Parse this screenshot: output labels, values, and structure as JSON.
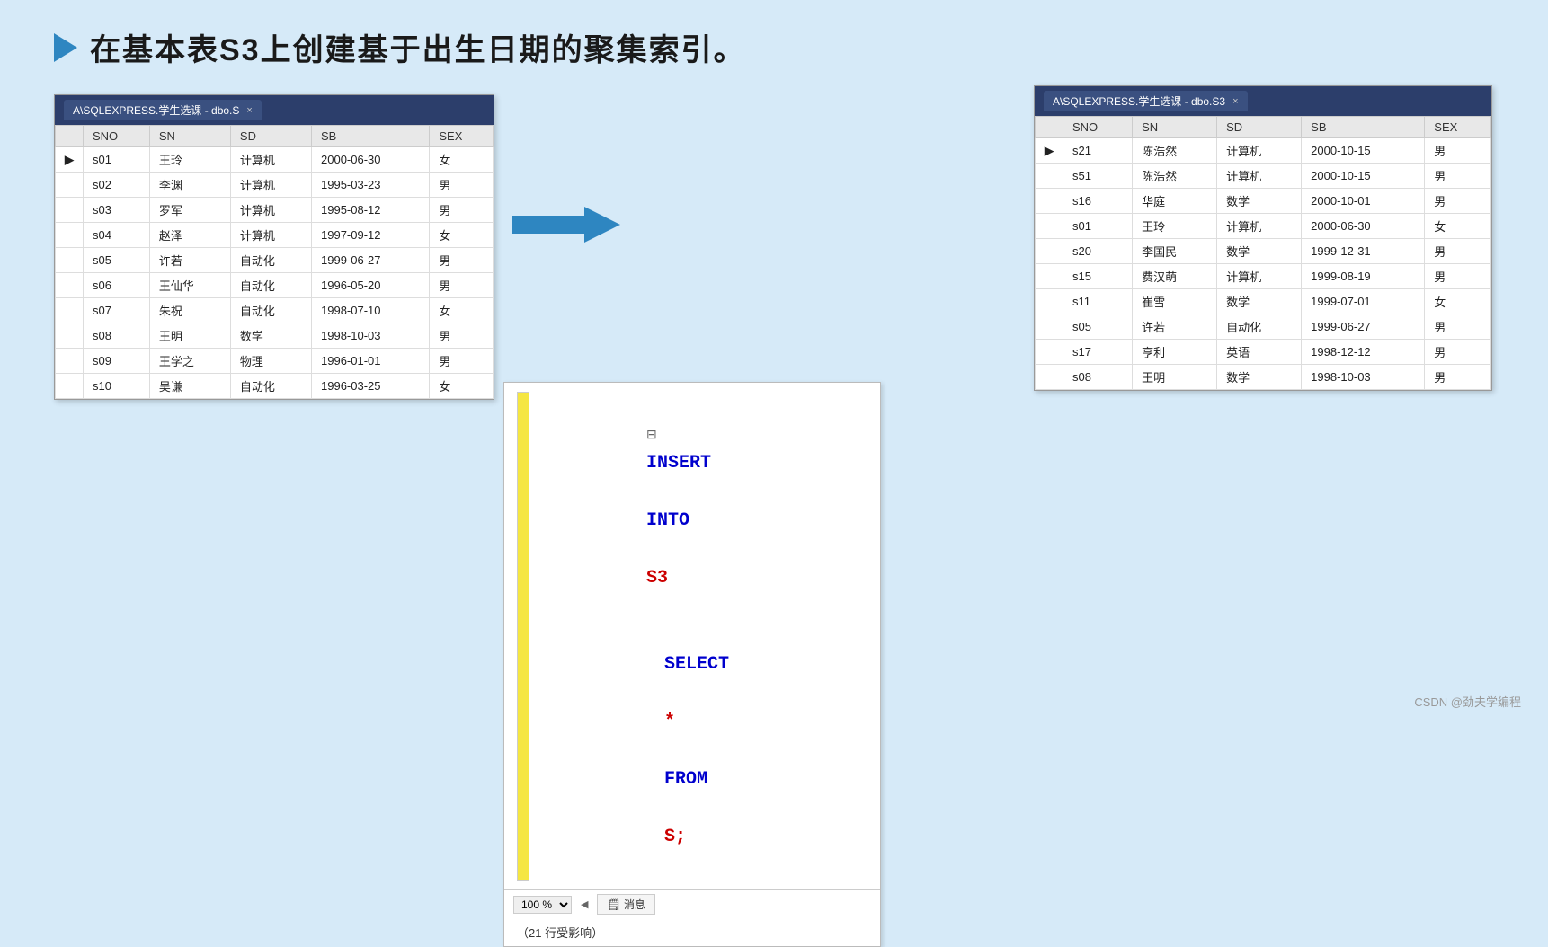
{
  "title": {
    "arrow": "▶",
    "text": "在基本表S3上创建基于出生日期的聚集索引。"
  },
  "left_table": {
    "header": "A\\SQLEXPRESS.学生选课 - dbo.S",
    "close": "×",
    "columns": [
      "",
      "SNO",
      "SN",
      "SD",
      "SB",
      "SEX"
    ],
    "rows": [
      {
        "indicator": "▶",
        "sno": "s01",
        "sn": "王玲",
        "sd": "计算机",
        "sb": "2000-06-30",
        "sex": "女"
      },
      {
        "indicator": "",
        "sno": "s02",
        "sn": "李渊",
        "sd": "计算机",
        "sb": "1995-03-23",
        "sex": "男"
      },
      {
        "indicator": "",
        "sno": "s03",
        "sn": "罗军",
        "sd": "计算机",
        "sb": "1995-08-12",
        "sex": "男"
      },
      {
        "indicator": "",
        "sno": "s04",
        "sn": "赵泽",
        "sd": "计算机",
        "sb": "1997-09-12",
        "sex": "女"
      },
      {
        "indicator": "",
        "sno": "s05",
        "sn": "许若",
        "sd": "自动化",
        "sb": "1999-06-27",
        "sex": "男"
      },
      {
        "indicator": "",
        "sno": "s06",
        "sn": "王仙华",
        "sd": "自动化",
        "sb": "1996-05-20",
        "sex": "男"
      },
      {
        "indicator": "",
        "sno": "s07",
        "sn": "朱祝",
        "sd": "自动化",
        "sb": "1998-07-10",
        "sex": "女"
      },
      {
        "indicator": "",
        "sno": "s08",
        "sn": "王明",
        "sd": "数学",
        "sb": "1998-10-03",
        "sex": "男"
      },
      {
        "indicator": "",
        "sno": "s09",
        "sn": "王学之",
        "sd": "物理",
        "sb": "1996-01-01",
        "sex": "男"
      },
      {
        "indicator": "",
        "sno": "s10",
        "sn": "吴谦",
        "sd": "自动化",
        "sb": "1996-03-25",
        "sex": "女"
      }
    ]
  },
  "right_table": {
    "header": "A\\SQLEXPRESS.学生选课 - dbo.S3",
    "close": "×",
    "columns": [
      "",
      "SNO",
      "SN",
      "SD",
      "SB",
      "SEX"
    ],
    "rows": [
      {
        "indicator": "▶",
        "sno": "s21",
        "sn": "陈浩然",
        "sd": "计算机",
        "sb": "2000-10-15",
        "sex": "男"
      },
      {
        "indicator": "",
        "sno": "s51",
        "sn": "陈浩然",
        "sd": "计算机",
        "sb": "2000-10-15",
        "sex": "男"
      },
      {
        "indicator": "",
        "sno": "s16",
        "sn": "华庭",
        "sd": "数学",
        "sb": "2000-10-01",
        "sex": "男"
      },
      {
        "indicator": "",
        "sno": "s01",
        "sn": "王玲",
        "sd": "计算机",
        "sb": "2000-06-30",
        "sex": "女"
      },
      {
        "indicator": "",
        "sno": "s20",
        "sn": "李国民",
        "sd": "数学",
        "sb": "1999-12-31",
        "sex": "男"
      },
      {
        "indicator": "",
        "sno": "s15",
        "sn": "费汉萌",
        "sd": "计算机",
        "sb": "1999-08-19",
        "sex": "男"
      },
      {
        "indicator": "",
        "sno": "s11",
        "sn": "崔雪",
        "sd": "数学",
        "sb": "1999-07-01",
        "sex": "女"
      },
      {
        "indicator": "",
        "sno": "s05",
        "sn": "许若",
        "sd": "自动化",
        "sb": "1999-06-27",
        "sex": "男"
      },
      {
        "indicator": "",
        "sno": "s17",
        "sn": "亨利",
        "sd": "英语",
        "sb": "1998-12-12",
        "sex": "男"
      },
      {
        "indicator": "",
        "sno": "s08",
        "sn": "王明",
        "sd": "数学",
        "sb": "1998-10-03",
        "sex": "男"
      }
    ]
  },
  "sql": {
    "line1_kw1": "INSERT",
    "line1_kw2": "INTO",
    "line1_table": "S3",
    "line2_kw1": "SELECT",
    "line2_op": "*",
    "line2_kw2": "FROM",
    "line2_table": "S;"
  },
  "sql_footer": {
    "zoom": "100 %",
    "msg_tab": "消息"
  },
  "msg": {
    "text": "（21 行受影响）"
  },
  "watermark": "CSDN @劲夫学编程"
}
